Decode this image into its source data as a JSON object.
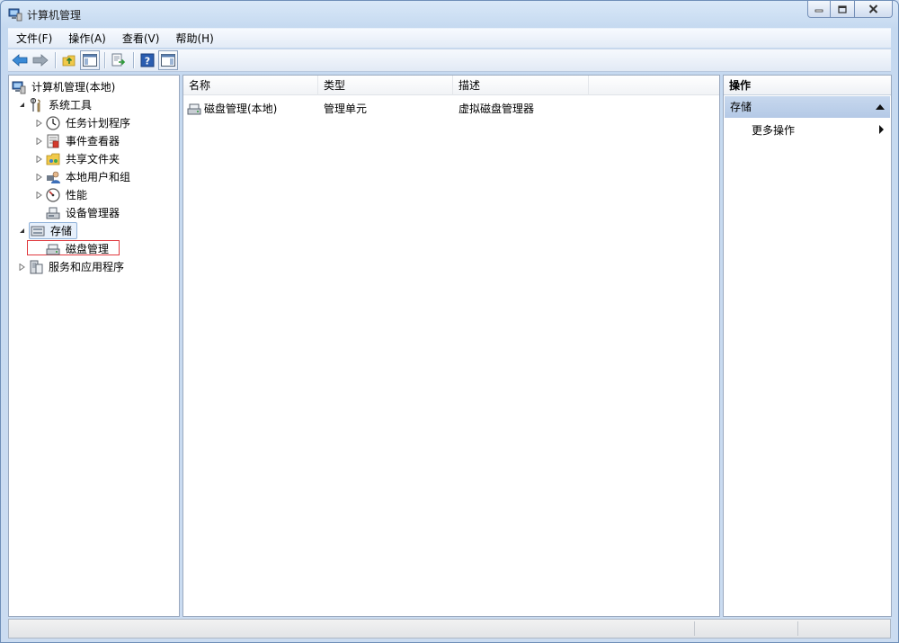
{
  "window": {
    "title": "计算机管理"
  },
  "menu": [
    "文件(F)",
    "操作(A)",
    "查看(V)",
    "帮助(H)"
  ],
  "tree": {
    "root": "计算机管理(本地)",
    "system_tools": "系统工具",
    "task_scheduler": "任务计划程序",
    "event_viewer": "事件查看器",
    "shared_folders": "共享文件夹",
    "local_users": "本地用户和组",
    "performance": "性能",
    "device_manager": "设备管理器",
    "storage": "存储",
    "disk_management": "磁盘管理",
    "services": "服务和应用程序"
  },
  "list": {
    "columns": [
      "名称",
      "类型",
      "描述"
    ],
    "rows": [
      {
        "name": "磁盘管理(本地)",
        "type": "管理单元",
        "desc": "虚拟磁盘管理器"
      }
    ]
  },
  "actions": {
    "header": "操作",
    "section": "存储",
    "more": "更多操作"
  },
  "colors": {
    "selection_highlight": "#e0393e",
    "action_section_bg": "#bcd0ea"
  }
}
